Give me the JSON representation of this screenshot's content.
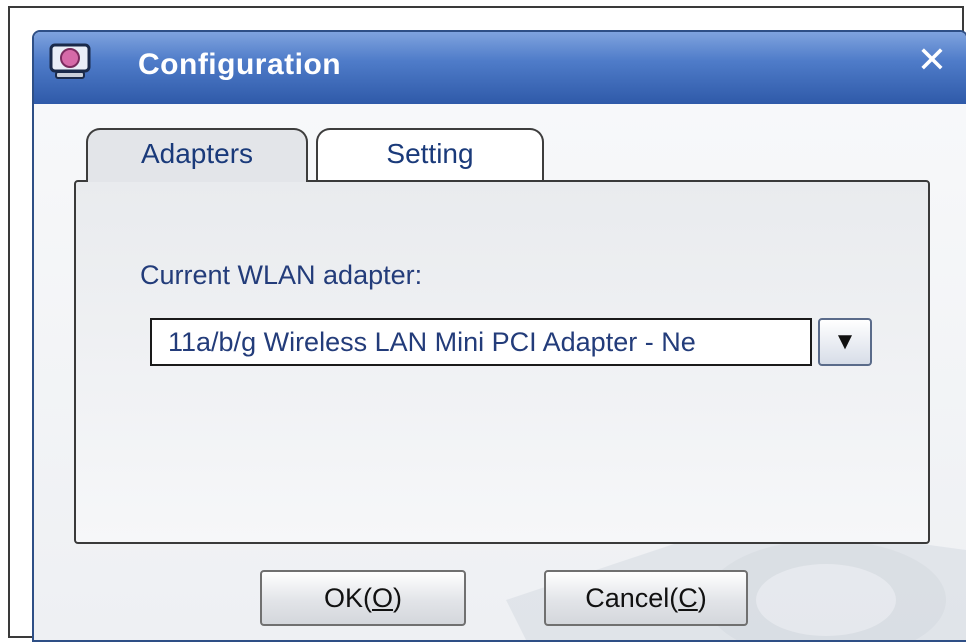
{
  "window": {
    "title": "Configuration",
    "close_glyph": "✕",
    "title_icon": "app-monitor-icon",
    "close_icon": "close-icon"
  },
  "tabs": [
    {
      "label": "Adapters",
      "active": true
    },
    {
      "label": "Setting",
      "active": false
    }
  ],
  "adapters_panel": {
    "label": "Current WLAN adapter:",
    "selected_adapter": "11a/b/g Wireless LAN Mini PCI Adapter - Ne",
    "dropdown_glyph": "▼"
  },
  "buttons": {
    "ok_label": "OK(O)",
    "cancel_label": "Cancel(C)"
  },
  "colors": {
    "titlebar": "#3a66b5",
    "text_blue": "#233c7a"
  }
}
